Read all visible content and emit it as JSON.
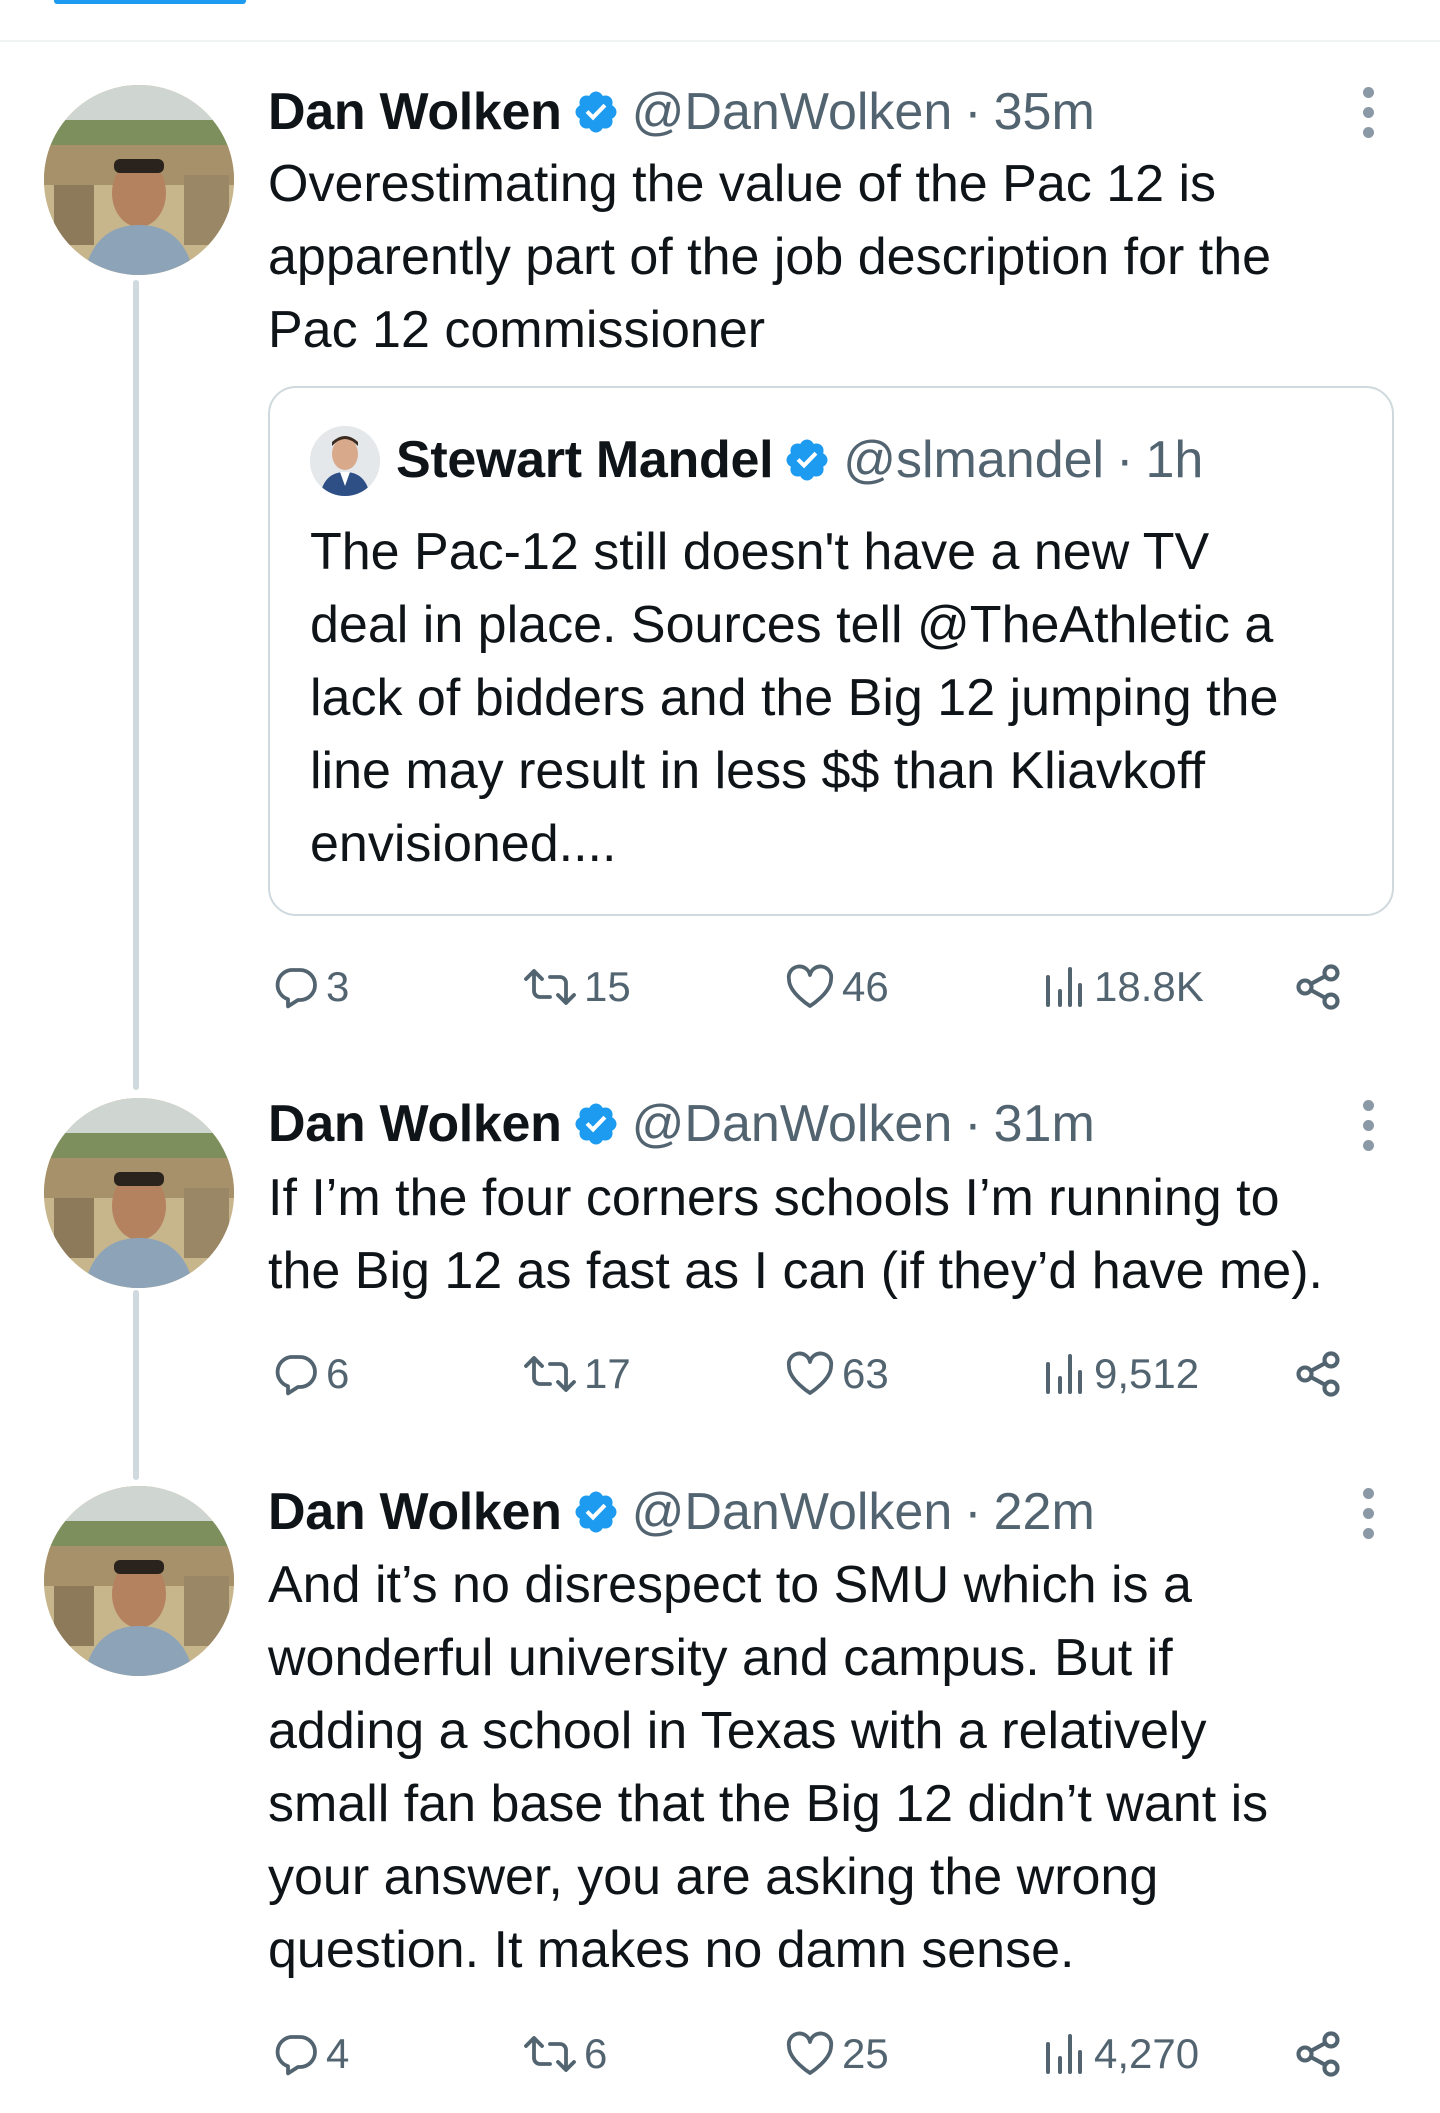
{
  "colors": {
    "accent": "#1d9bf0",
    "secondary_text": "#536471",
    "primary_text": "#0f1419",
    "border": "#cfd9de"
  },
  "tweets": [
    {
      "name": "Dan Wolken",
      "handle": "@DanWolken",
      "separator": "·",
      "time": "35m",
      "text_lines": [
        "Overestimating the value of the Pac 12 is",
        "apparently part of the job description for the",
        "Pac 12 commissioner"
      ],
      "quote": {
        "name": "Stewart Mandel",
        "handle": "@slmandel",
        "separator": "·",
        "time": "1h",
        "text_lines": [
          "The Pac-12 still doesn't have a new TV",
          "deal in place. Sources tell @TheAthletic a",
          "lack of bidders and the Big 12 jumping the",
          "line may result in less $$ than Kliavkoff",
          "envisioned...."
        ]
      },
      "replies": "3",
      "retweets": "15",
      "likes": "46",
      "views": "18.8K"
    },
    {
      "name": "Dan Wolken",
      "handle": "@DanWolken",
      "separator": "·",
      "time": "31m",
      "text_lines": [
        "If I’m the four corners schools I’m running to",
        "the Big 12 as fast as I can (if they’d have me)."
      ],
      "replies": "6",
      "retweets": "17",
      "likes": "63",
      "views": "9,512"
    },
    {
      "name": "Dan Wolken",
      "handle": "@DanWolken",
      "separator": "·",
      "time": "22m",
      "text_lines": [
        "And it’s no disrespect to SMU which is a",
        "wonderful university and campus. But if",
        "adding a school in Texas with a relatively",
        "small fan base that the Big 12 didn’t want is",
        "your answer, you are asking the wrong",
        "question. It makes no damn sense."
      ],
      "replies": "4",
      "retweets": "6",
      "likes": "25",
      "views": "4,270"
    }
  ]
}
